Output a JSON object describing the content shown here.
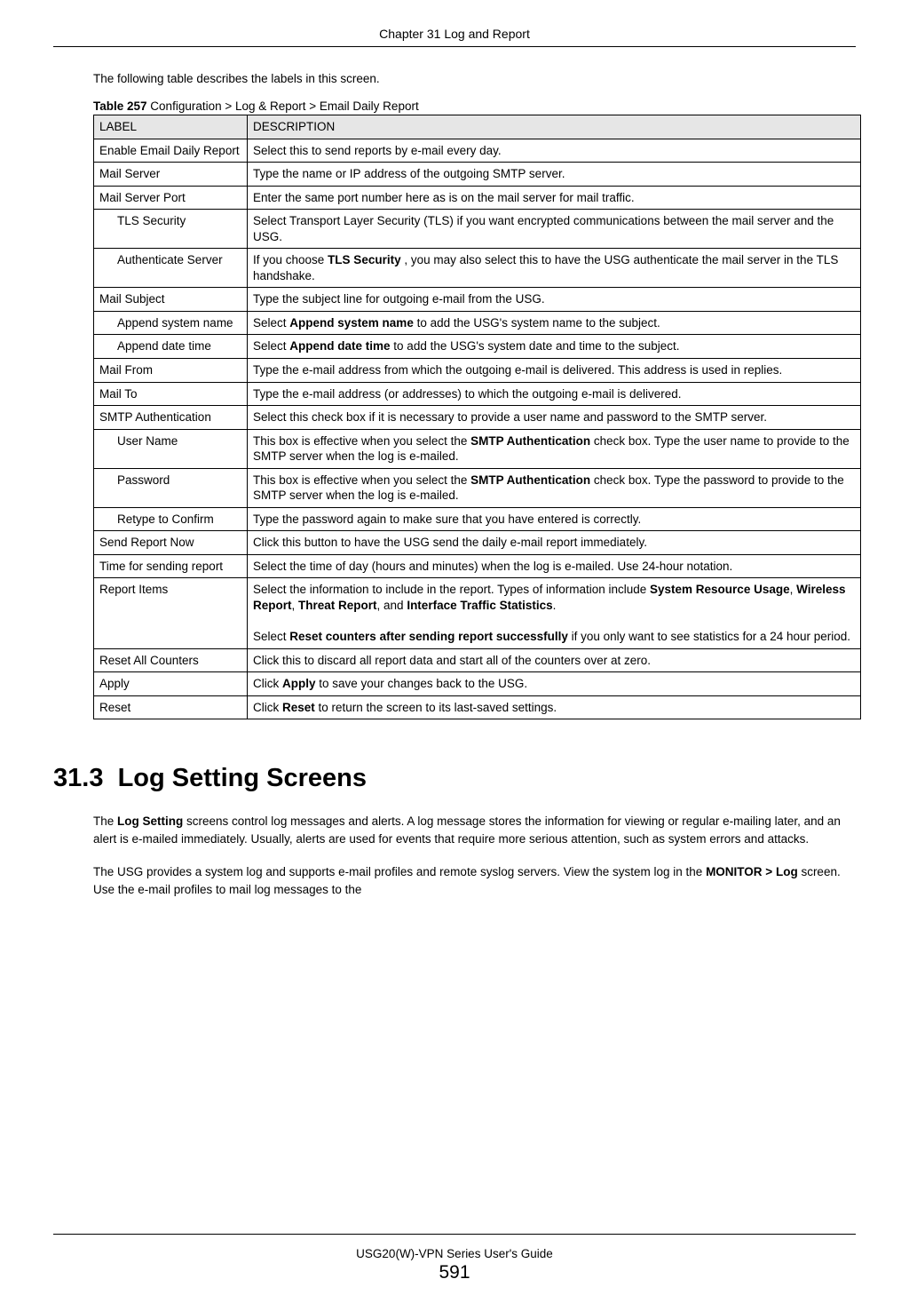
{
  "header": {
    "chapter": "Chapter 31 Log and Report"
  },
  "intro": "The following table describes the labels in this screen.",
  "tableCaption": {
    "prefix": "Table 257",
    "title": "   Configuration > Log & Report > Email Daily Report"
  },
  "tableHeader": {
    "label": "LABEL",
    "description": "DESCRIPTION"
  },
  "rows": [
    {
      "label": "Enable Email Daily Report",
      "indent": false,
      "desc": [
        [
          "",
          "Select this to send reports by e-mail every day."
        ]
      ]
    },
    {
      "label": "Mail Server",
      "indent": false,
      "desc": [
        [
          "",
          "Type the name or IP address of the outgoing SMTP server."
        ]
      ]
    },
    {
      "label": "Mail Server Port",
      "indent": false,
      "desc": [
        [
          "",
          "Enter the same port number here as is on the mail server for mail traffic."
        ]
      ]
    },
    {
      "label": "TLS Security",
      "indent": true,
      "desc": [
        [
          "",
          "Select Transport Layer Security (TLS) if you want encrypted communications between the mail server and the USG."
        ]
      ]
    },
    {
      "label": "Authenticate Server",
      "indent": true,
      "desc": [
        [
          "",
          "If you choose "
        ],
        [
          "b",
          "TLS Security"
        ],
        [
          "",
          " , you may also select this to have the USG authenticate the mail server in the TLS handshake."
        ]
      ]
    },
    {
      "label": "Mail Subject",
      "indent": false,
      "desc": [
        [
          "",
          "Type the subject line for  outgoing e-mail from the USG."
        ]
      ]
    },
    {
      "label": "Append system name",
      "indent": true,
      "desc": [
        [
          "",
          "Select "
        ],
        [
          "b",
          "Append system name"
        ],
        [
          "",
          " to add the USG's system name to the subject."
        ]
      ]
    },
    {
      "label": "Append date time",
      "indent": true,
      "desc": [
        [
          "",
          "Select "
        ],
        [
          "b",
          "Append date time"
        ],
        [
          "",
          " to add the USG's system date and time to the subject."
        ]
      ]
    },
    {
      "label": "Mail From",
      "indent": false,
      "desc": [
        [
          "",
          "Type the e-mail address from which the outgoing e-mail is delivered. This address is used in replies."
        ]
      ]
    },
    {
      "label": "Mail To",
      "indent": false,
      "desc": [
        [
          "",
          "Type the e-mail address (or addresses) to which the outgoing e-mail is delivered."
        ]
      ]
    },
    {
      "label": "SMTP Authentication",
      "indent": false,
      "desc": [
        [
          "",
          "Select this check box if it is necessary to provide a user name and password to the SMTP server."
        ]
      ]
    },
    {
      "label": "User Name",
      "indent": true,
      "desc": [
        [
          "",
          "This box is effective when you select the "
        ],
        [
          "b",
          "SMTP Authentication"
        ],
        [
          "",
          " check box. Type the user name to provide to the SMTP server when the log is e-mailed."
        ]
      ]
    },
    {
      "label": "Password",
      "indent": true,
      "desc": [
        [
          "",
          "This box is effective when you select the "
        ],
        [
          "b",
          "SMTP Authentication"
        ],
        [
          "",
          " check box. Type the password to provide to the SMTP server when the log is e-mailed."
        ]
      ]
    },
    {
      "label": "Retype to Confirm",
      "indent": true,
      "desc": [
        [
          "",
          "Type the password again to make sure that you  have entered is correctly."
        ]
      ]
    },
    {
      "label": "Send Report Now",
      "indent": false,
      "desc": [
        [
          "",
          "Click this button to have the USG send the daily e-mail report immediately."
        ]
      ]
    },
    {
      "label": "Time for sending report",
      "indent": false,
      "desc": [
        [
          "",
          "Select the time of day (hours and minutes) when the log is e-mailed. Use 24-hour notation."
        ]
      ]
    },
    {
      "label": "Report Items",
      "indent": false,
      "desc": [
        [
          "",
          "Select the information to include in the report. Types of information include "
        ],
        [
          "b",
          "System Resource Usage"
        ],
        [
          "",
          ", "
        ],
        [
          "b",
          "Wireless Report"
        ],
        [
          "",
          ", "
        ],
        [
          "b",
          "Threat Report"
        ],
        [
          "",
          ", and "
        ],
        [
          "b",
          "Interface Traffic Statistics"
        ],
        [
          "",
          ".\n\nSelect "
        ],
        [
          "b",
          "Reset counters after sending report successfully"
        ],
        [
          "",
          " if you only want to see statistics for a 24 hour period."
        ]
      ]
    },
    {
      "label": "Reset All Counters",
      "indent": false,
      "desc": [
        [
          "",
          "Click this to discard all report data and start all of the counters over at zero."
        ]
      ]
    },
    {
      "label": "Apply",
      "indent": false,
      "desc": [
        [
          "",
          "Click "
        ],
        [
          "b",
          "Apply"
        ],
        [
          "",
          " to save your changes back to the USG."
        ]
      ]
    },
    {
      "label": "Reset",
      "indent": false,
      "desc": [
        [
          "",
          "Click "
        ],
        [
          "b",
          "Reset"
        ],
        [
          "",
          " to return the screen to its last-saved settings."
        ]
      ]
    }
  ],
  "section": {
    "number": "31.3",
    "title": "Log Setting Screens"
  },
  "paragraphs": [
    [
      [
        "",
        "The "
      ],
      [
        "b",
        "Log Setting"
      ],
      [
        "",
        " screens control log messages and alerts. A log message stores the information for viewing or regular e-mailing later, and an alert is e-mailed immediately. Usually, alerts are used for events that require more serious attention, such as system errors and attacks."
      ]
    ],
    [
      [
        "",
        "The USG provides a system log and supports e-mail profiles and remote syslog servers. View the system log in the "
      ],
      [
        "b",
        "MONITOR > Log"
      ],
      [
        "",
        " screen. Use the e-mail profiles to mail log messages to the"
      ]
    ]
  ],
  "footer": {
    "guide": "USG20(W)-VPN Series User's Guide",
    "page": "591"
  }
}
